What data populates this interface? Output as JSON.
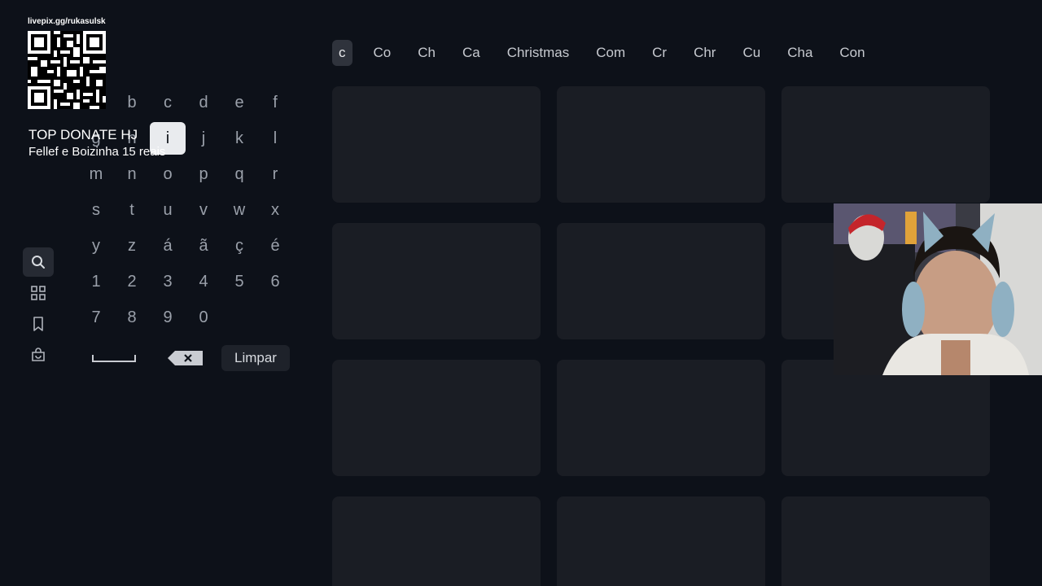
{
  "navigation": {
    "items": [
      {
        "name": "search",
        "active": true
      },
      {
        "name": "grid"
      },
      {
        "name": "bookmark"
      },
      {
        "name": "store"
      }
    ]
  },
  "keyboard": {
    "rows": [
      [
        "a",
        "b",
        "c",
        "d",
        "e",
        "f"
      ],
      [
        "g",
        "h",
        "i",
        "j",
        "k",
        "l"
      ],
      [
        "m",
        "n",
        "o",
        "p",
        "q",
        "r"
      ],
      [
        "s",
        "t",
        "u",
        "v",
        "w",
        "x"
      ],
      [
        "y",
        "z",
        "á",
        "ã",
        "ç",
        "é"
      ],
      [
        "1",
        "2",
        "3",
        "4",
        "5",
        "6"
      ],
      [
        "7",
        "8",
        "9",
        "0"
      ]
    ],
    "focused_key": "i",
    "clear_label": "Limpar"
  },
  "suggestions": [
    "c",
    "Co",
    "Ch",
    "Ca",
    "Christmas",
    "Com",
    "Cr",
    "Chr",
    "Cu",
    "Cha",
    "Con"
  ],
  "selected_suggestion": "c",
  "results_grid": {
    "rows": 4,
    "columns": 3
  },
  "overlay": {
    "qr_url": "livepix.gg/rukasulsk",
    "donate_title": "TOP DONATE HJ",
    "donate_line": "Fellef e Boizinha 15 reais"
  }
}
